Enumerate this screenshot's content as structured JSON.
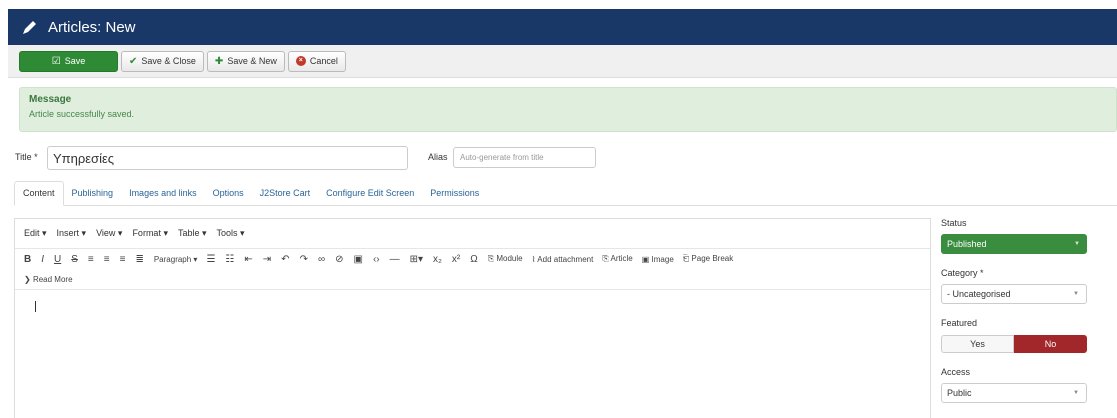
{
  "header": {
    "title": "Articles: New"
  },
  "toolbar": {
    "save": "Save",
    "save_close": "Save & Close",
    "save_new": "Save & New",
    "cancel": "Cancel"
  },
  "message": {
    "heading": "Message",
    "text": "Article successfully saved."
  },
  "form": {
    "title_label": "Title *",
    "title_value": "Υπηρεσίες",
    "alias_label": "Alias",
    "alias_placeholder": "Auto-generate from title"
  },
  "tabs": [
    "Content",
    "Publishing",
    "Images and links",
    "Options",
    "J2Store Cart",
    "Configure Edit Screen",
    "Permissions"
  ],
  "editor": {
    "menus": [
      "Edit ▾",
      "Insert ▾",
      "View ▾",
      "Format ▾",
      "Table ▾",
      "Tools ▾"
    ],
    "paragraph": "Paragraph",
    "module": "Module",
    "add_attachment": "Add attachment",
    "article": "Article",
    "image": "Image",
    "page_break": "Page Break",
    "read_more": "Read More"
  },
  "sidebar": {
    "status_label": "Status",
    "status_value": "Published",
    "category_label": "Category *",
    "category_value": "- Uncategorised",
    "featured_label": "Featured",
    "featured_yes": "Yes",
    "featured_no": "No",
    "access_label": "Access",
    "access_value": "Public"
  },
  "colors": {
    "header": "#1a3867",
    "success": "#2f8a36",
    "danger": "#a1272a",
    "message_bg": "#dfeedd"
  }
}
